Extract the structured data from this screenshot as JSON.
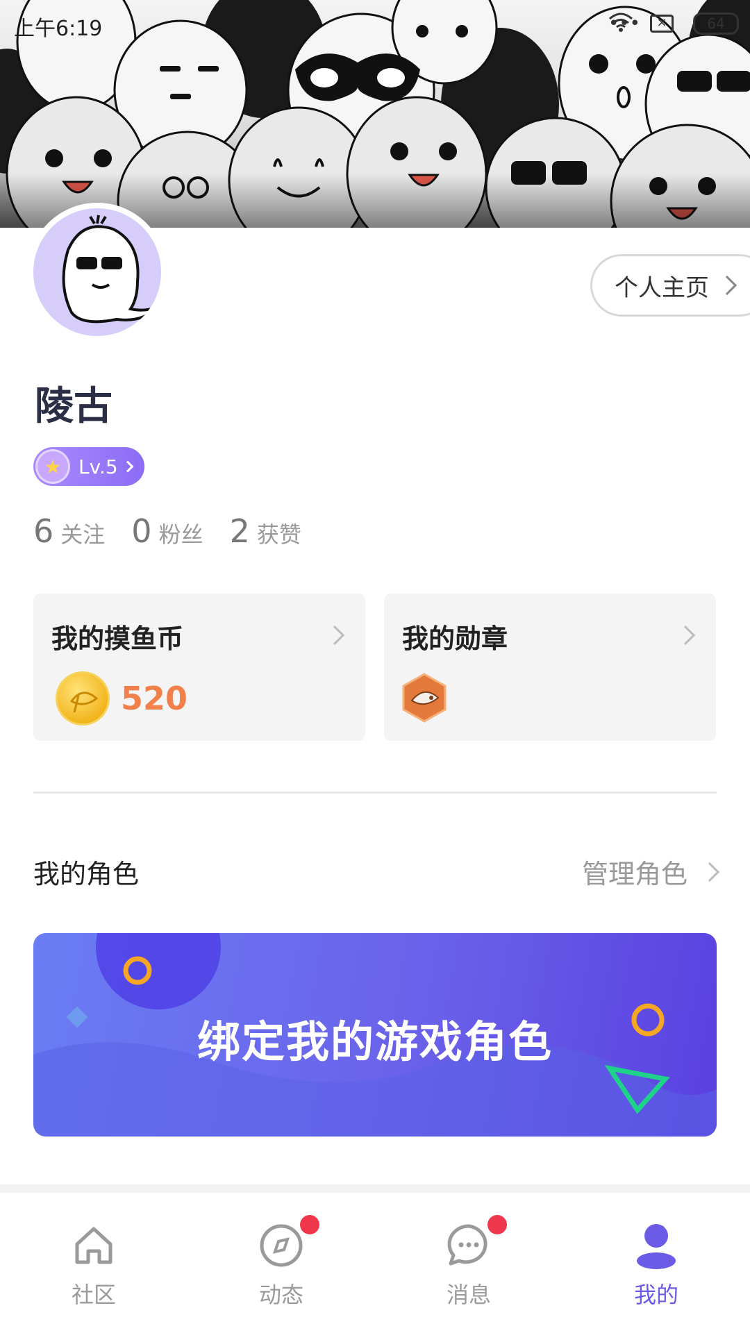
{
  "status_bar": {
    "time": "上午6:19",
    "dots": "•••",
    "battery": "64"
  },
  "profile": {
    "home_button": "个人主页",
    "username": "陵古",
    "level": "Lv.5",
    "stats": [
      {
        "num": "6",
        "label": "关注"
      },
      {
        "num": "0",
        "label": "粉丝"
      },
      {
        "num": "2",
        "label": "获赞"
      }
    ]
  },
  "cards": {
    "coins": {
      "title": "我的摸鱼币",
      "value": "520"
    },
    "medals": {
      "title": "我的勋章"
    }
  },
  "roles": {
    "title": "我的角色",
    "manage": "管理角色",
    "bind_banner": "绑定我的游戏角色"
  },
  "tabbar": {
    "items": [
      {
        "label": "社区",
        "icon": "home-icon",
        "badge": false
      },
      {
        "label": "动态",
        "icon": "compass-icon",
        "badge": true
      },
      {
        "label": "消息",
        "icon": "chat-icon",
        "badge": true
      },
      {
        "label": "我的",
        "icon": "user-icon",
        "badge": false,
        "active": true
      }
    ]
  },
  "colors": {
    "accent": "#6b5be6",
    "coin_value": "#f2804a",
    "badge_red": "#f0384c"
  }
}
